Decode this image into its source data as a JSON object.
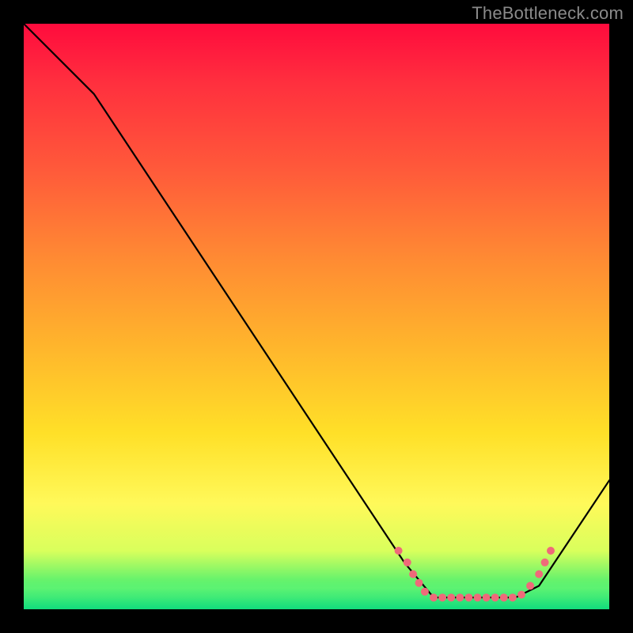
{
  "watermark": "TheBottleneck.com",
  "chart_data": {
    "type": "line",
    "title": "",
    "xlabel": "",
    "ylabel": "",
    "xlim": [
      0,
      100
    ],
    "ylim": [
      0,
      100
    ],
    "series": [
      {
        "name": "curve",
        "x": [
          0,
          12,
          65,
          70,
          84,
          88,
          100
        ],
        "y": [
          100,
          88,
          8,
          2,
          2,
          4,
          22
        ]
      }
    ],
    "markers": [
      {
        "x": 64,
        "y": 10
      },
      {
        "x": 65.5,
        "y": 8
      },
      {
        "x": 66.5,
        "y": 6
      },
      {
        "x": 67.5,
        "y": 4.5
      },
      {
        "x": 68.5,
        "y": 3
      },
      {
        "x": 70,
        "y": 2
      },
      {
        "x": 71.5,
        "y": 2
      },
      {
        "x": 73,
        "y": 2
      },
      {
        "x": 74.5,
        "y": 2
      },
      {
        "x": 76,
        "y": 2
      },
      {
        "x": 77.5,
        "y": 2
      },
      {
        "x": 79,
        "y": 2
      },
      {
        "x": 80.5,
        "y": 2
      },
      {
        "x": 82,
        "y": 2
      },
      {
        "x": 83.5,
        "y": 2
      },
      {
        "x": 85,
        "y": 2.5
      },
      {
        "x": 86.5,
        "y": 4
      },
      {
        "x": 88,
        "y": 6
      },
      {
        "x": 89,
        "y": 8
      },
      {
        "x": 90,
        "y": 10
      }
    ],
    "colors": {
      "curve": "#000000",
      "marker": "#ef6a7a",
      "gradient_top": "#ff0b3d",
      "gradient_bottom": "#0be37a",
      "watermark": "#8a8a8a"
    }
  }
}
